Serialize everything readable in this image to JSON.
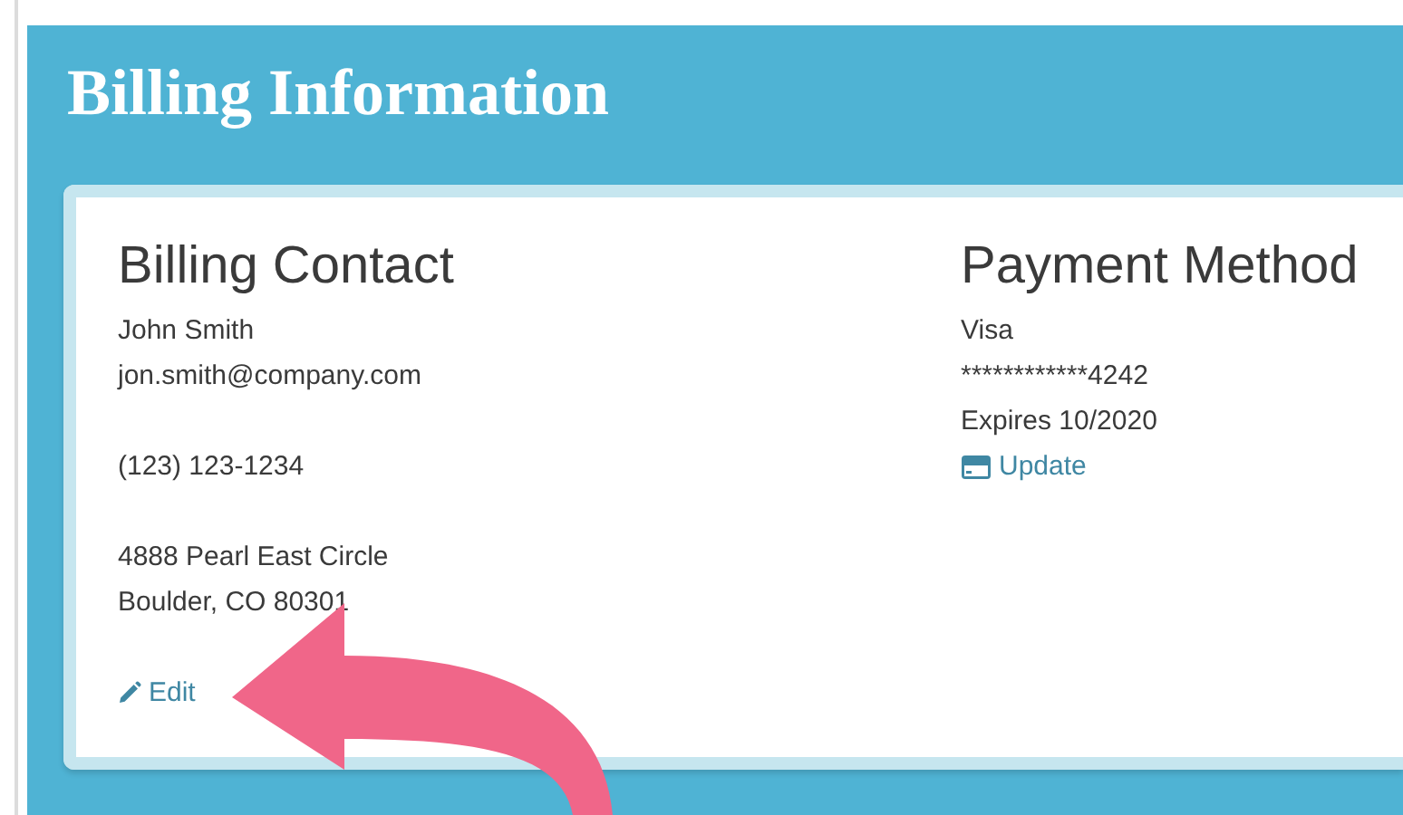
{
  "page": {
    "title": "Billing Information"
  },
  "columns": [
    {
      "heading": "Billing Contact",
      "blocks": [
        [
          {
            "kind": "text",
            "text": "John Smith"
          },
          {
            "kind": "text",
            "text": "jon.smith@company.com"
          }
        ],
        [
          {
            "kind": "text",
            "text": "(123) 123-1234"
          }
        ],
        [
          {
            "kind": "text",
            "text": "4888 Pearl East Circle"
          },
          {
            "kind": "text",
            "text": "Boulder, CO 80301"
          }
        ],
        [
          {
            "kind": "pencil-link",
            "text": "Edit"
          }
        ]
      ]
    },
    {
      "heading": "Payment Method",
      "blocks": [
        [
          {
            "kind": "text",
            "text": "Visa"
          },
          {
            "kind": "text",
            "text": "************4242"
          },
          {
            "kind": "text",
            "text": "Expires 10/2020"
          },
          {
            "kind": "card-link",
            "text": "Update"
          }
        ]
      ]
    }
  ],
  "annotation": {
    "kind": "arrow"
  }
}
